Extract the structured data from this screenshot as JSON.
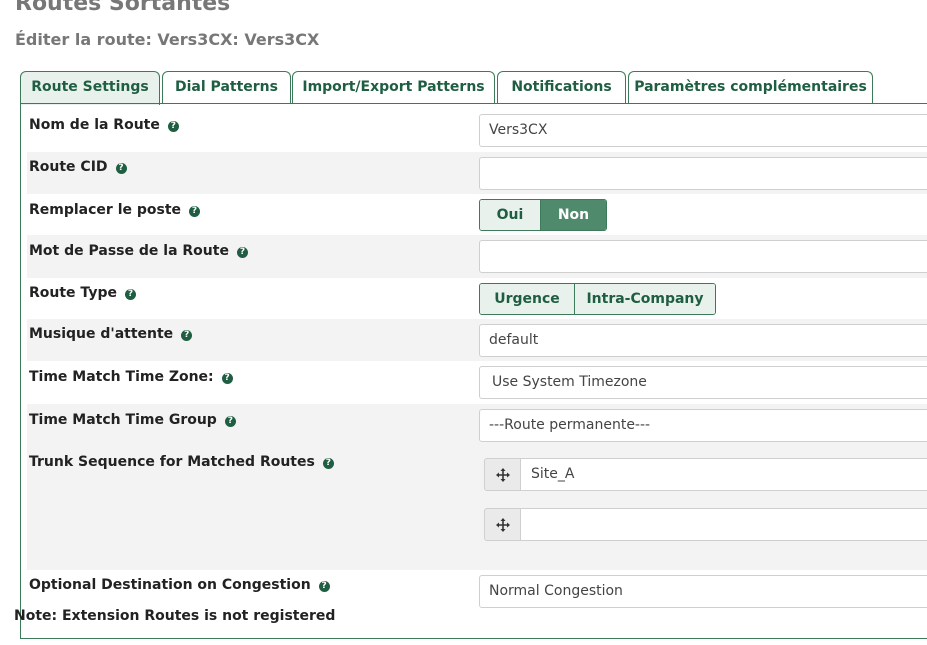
{
  "header": {
    "title": "Routes Sortantes",
    "subtitle": "Éditer la route: Vers3CX: Vers3CX"
  },
  "tabs": [
    {
      "label": "Route Settings",
      "active": true
    },
    {
      "label": "Dial Patterns",
      "active": false
    },
    {
      "label": "Import/Export Patterns",
      "active": false
    },
    {
      "label": "Notifications",
      "active": false
    },
    {
      "label": "Paramètres complémentaires",
      "active": false
    }
  ],
  "form": {
    "route_name": {
      "label": "Nom de la Route",
      "value": "Vers3CX"
    },
    "route_cid": {
      "label": "Route CID",
      "value": ""
    },
    "override_extension": {
      "label": "Remplacer le poste",
      "options": [
        "Oui",
        "Non"
      ],
      "selected": "Non"
    },
    "route_password": {
      "label": "Mot de Passe de la Route",
      "value": ""
    },
    "route_type": {
      "label": "Route Type",
      "options": [
        "Urgence",
        "Intra-Company"
      ]
    },
    "music_on_hold": {
      "label": "Musique d'attente",
      "value": "default"
    },
    "time_zone": {
      "label": "Time Match Time Zone:",
      "value": "Use System Timezone"
    },
    "time_group": {
      "label": "Time Match Time Group",
      "value": "---Route permanente---"
    },
    "trunk_sequence": {
      "label": "Trunk Sequence for Matched Routes",
      "trunks": [
        "Site_A",
        ""
      ]
    },
    "congestion": {
      "label": "Optional Destination on Congestion",
      "value": "Normal Congestion"
    }
  },
  "note": "Note: Extension Routes is not registered",
  "icons": {
    "help": "help-circle-icon",
    "drag": "move-icon"
  },
  "colors": {
    "accent": "#3d7a5a",
    "accent_dark": "#1f5e42",
    "selected_button": "#4f8a6d",
    "tab_bg": "#e8f1ec"
  }
}
